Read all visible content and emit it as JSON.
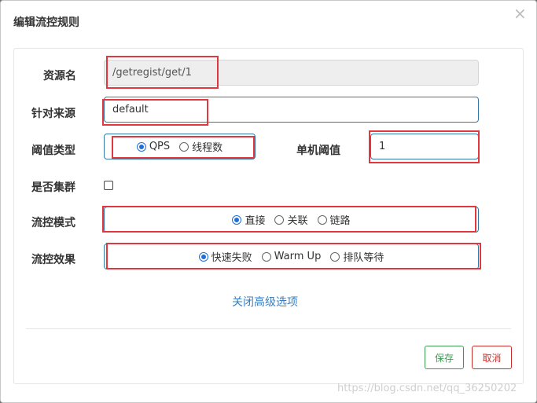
{
  "dialog": {
    "title": "编辑流控规则",
    "close_symbol": "×"
  },
  "form": {
    "resource_name": {
      "label": "资源名",
      "value": "/getregist/get/1"
    },
    "limit_app": {
      "label": "针对来源",
      "value": "default"
    },
    "threshold_type": {
      "label": "阈值类型",
      "options": [
        "QPS",
        "线程数"
      ],
      "selected": "QPS"
    },
    "single_threshold": {
      "label": "单机阈值",
      "value": "1"
    },
    "cluster_mode": {
      "label": "是否集群",
      "checked": false
    },
    "strategy": {
      "label": "流控模式",
      "options": [
        "直接",
        "关联",
        "链路"
      ],
      "selected": "直接"
    },
    "control_behavior": {
      "label": "流控效果",
      "options": [
        "快速失败",
        "Warm Up",
        "排队等待"
      ],
      "selected": "快速失败"
    },
    "advanced_link": "关闭高级选项"
  },
  "footer": {
    "save_label": "保存",
    "cancel_label": "取消"
  },
  "watermark": "https://blog.csdn.net/qq_36250202",
  "colors": {
    "highlight_box": "#e0383e",
    "input_border": "#3278a8",
    "save": "#3d9a52",
    "cancel": "#c9302c",
    "link": "#3a7fc2",
    "radio_checked": "#1e6fd9"
  }
}
